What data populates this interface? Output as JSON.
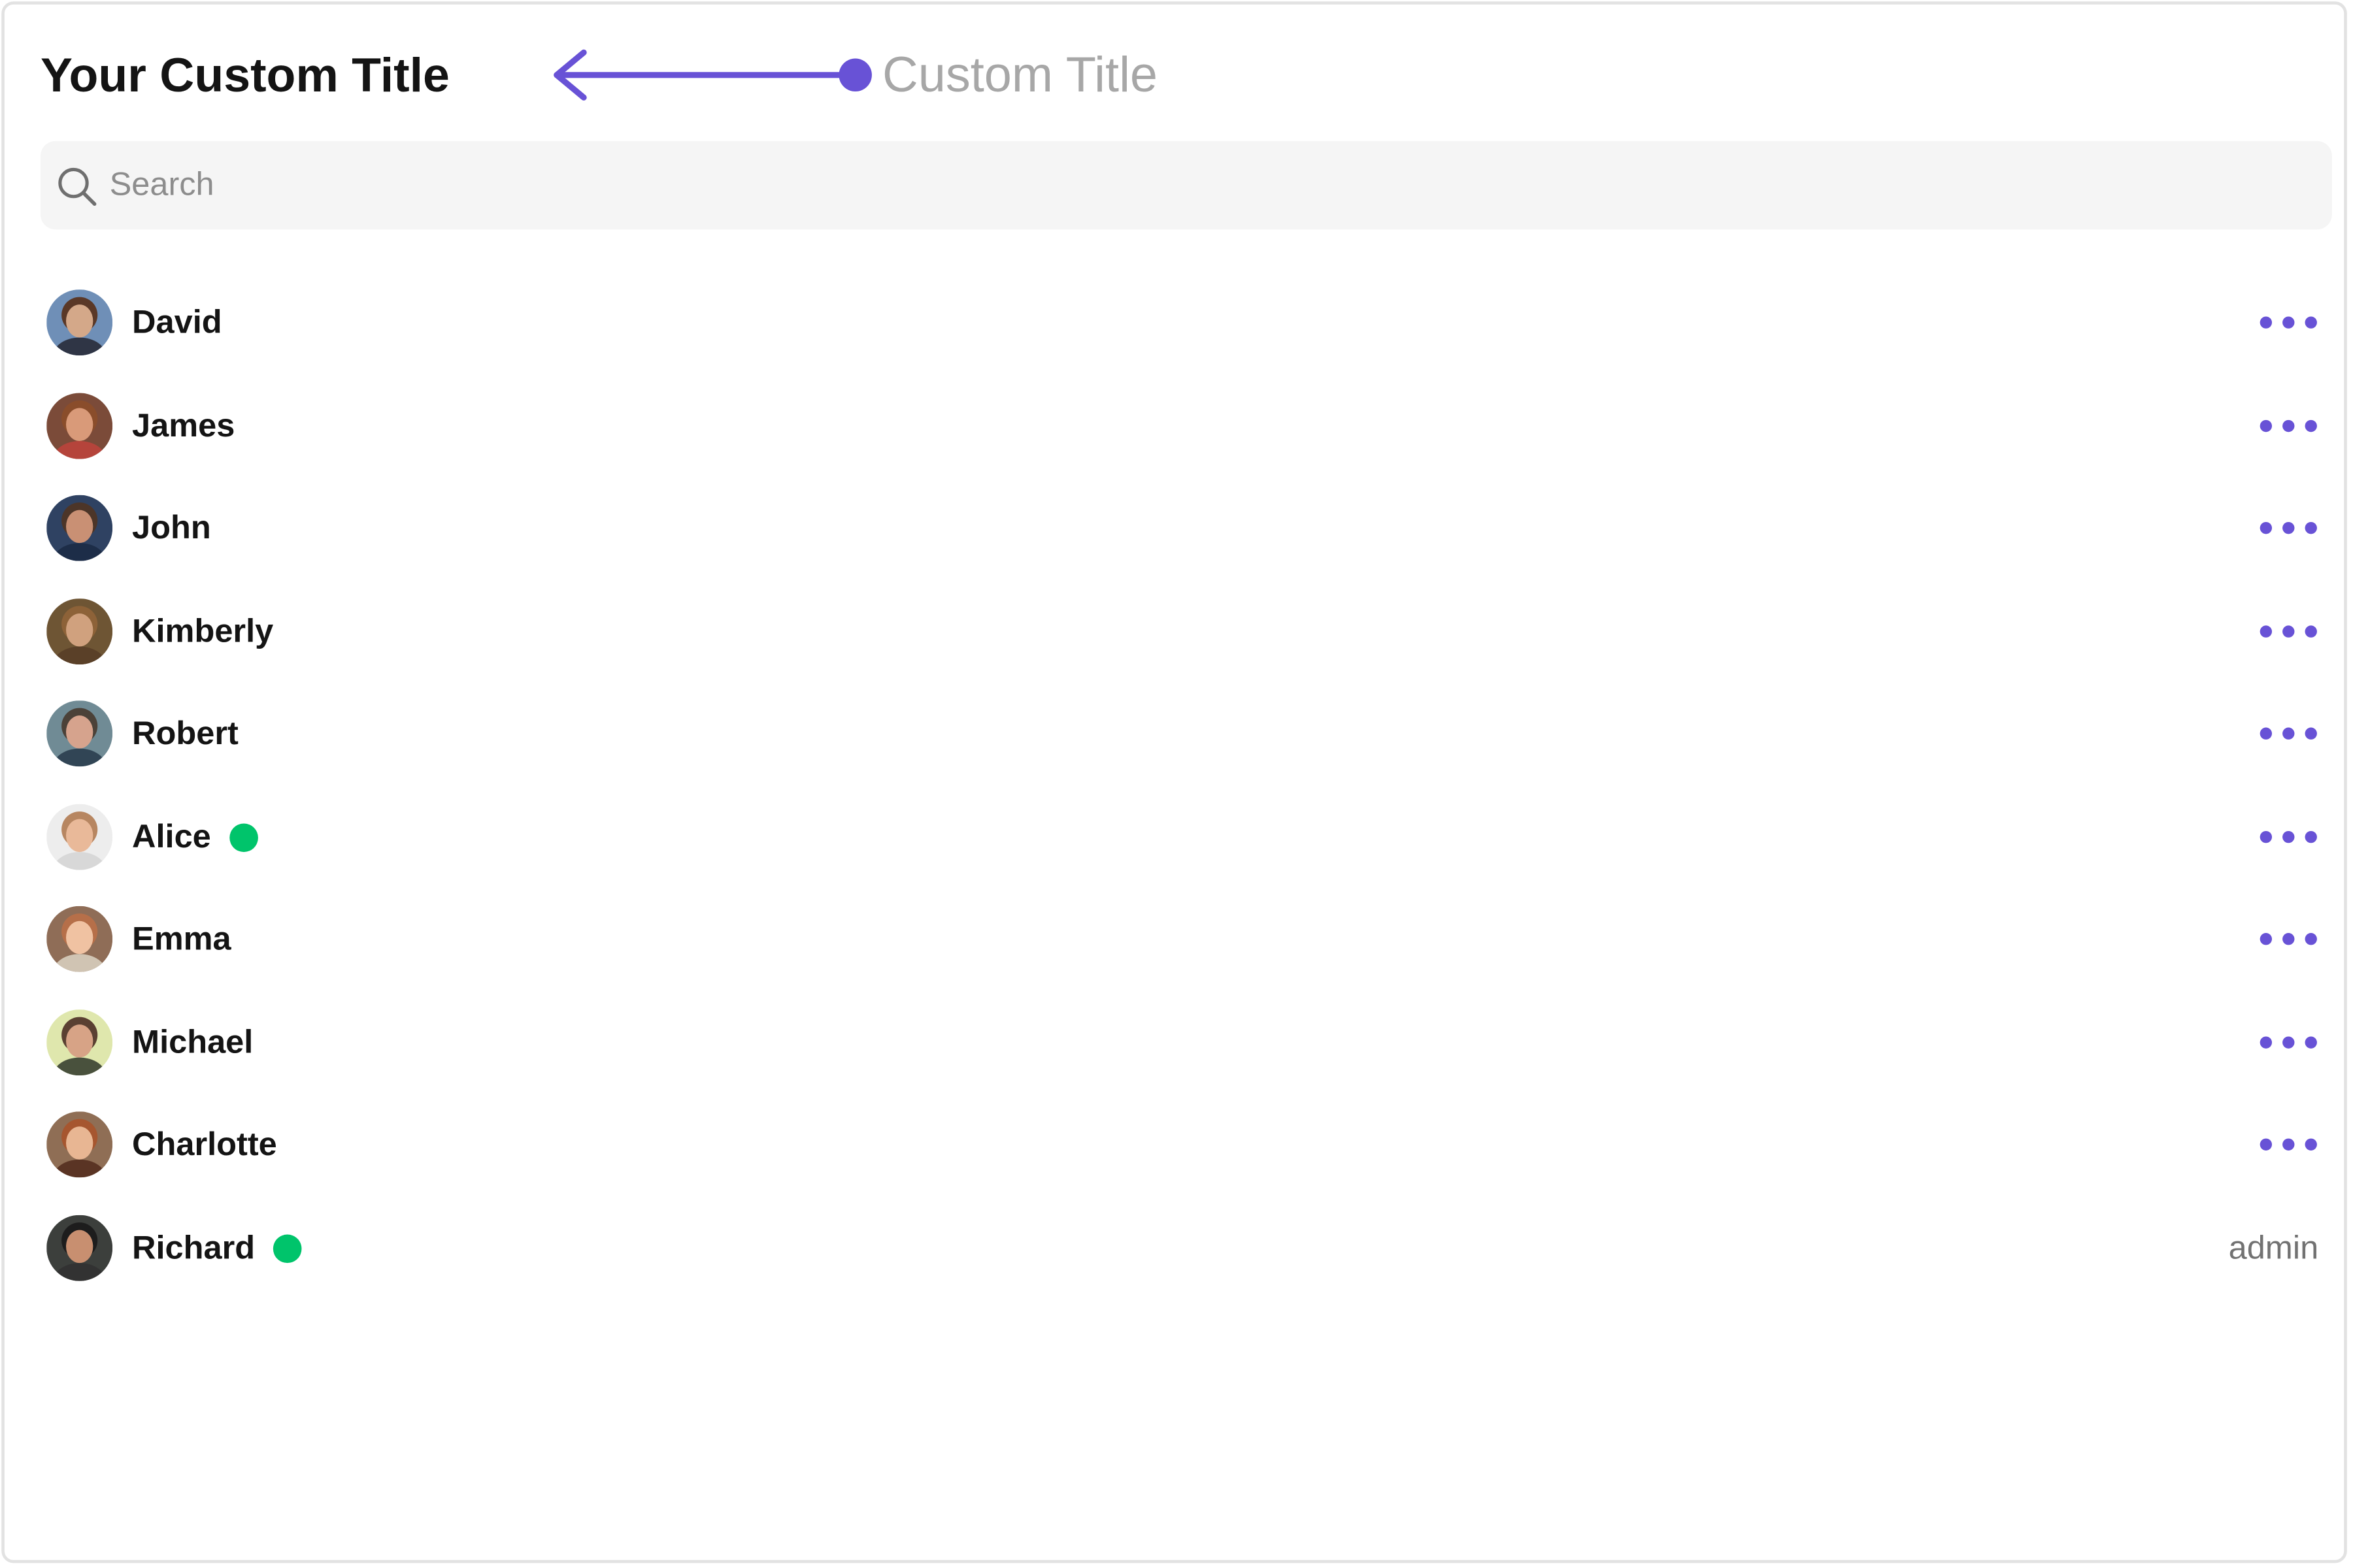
{
  "header": {
    "title": "Your Custom Title",
    "annotation_label": "Custom Title"
  },
  "search": {
    "placeholder": "Search"
  },
  "colors": {
    "accent": "#6852d6",
    "online": "#00c46b",
    "search_bg": "#f5f5f5",
    "annotation_text": "#a7a7a7"
  },
  "users": [
    {
      "name": "David",
      "online": false,
      "action": "more-options",
      "role": ""
    },
    {
      "name": "James",
      "online": false,
      "action": "more-options",
      "role": ""
    },
    {
      "name": "John",
      "online": false,
      "action": "more-options",
      "role": ""
    },
    {
      "name": "Kimberly",
      "online": false,
      "action": "more-options",
      "role": ""
    },
    {
      "name": "Robert",
      "online": false,
      "action": "more-options",
      "role": ""
    },
    {
      "name": "Alice",
      "online": true,
      "action": "more-options",
      "role": ""
    },
    {
      "name": "Emma",
      "online": false,
      "action": "more-options",
      "role": ""
    },
    {
      "name": "Michael",
      "online": false,
      "action": "more-options",
      "role": ""
    },
    {
      "name": "Charlotte",
      "online": false,
      "action": "more-options",
      "role": ""
    },
    {
      "name": "Richard",
      "online": true,
      "action": "none",
      "role": "admin"
    }
  ]
}
